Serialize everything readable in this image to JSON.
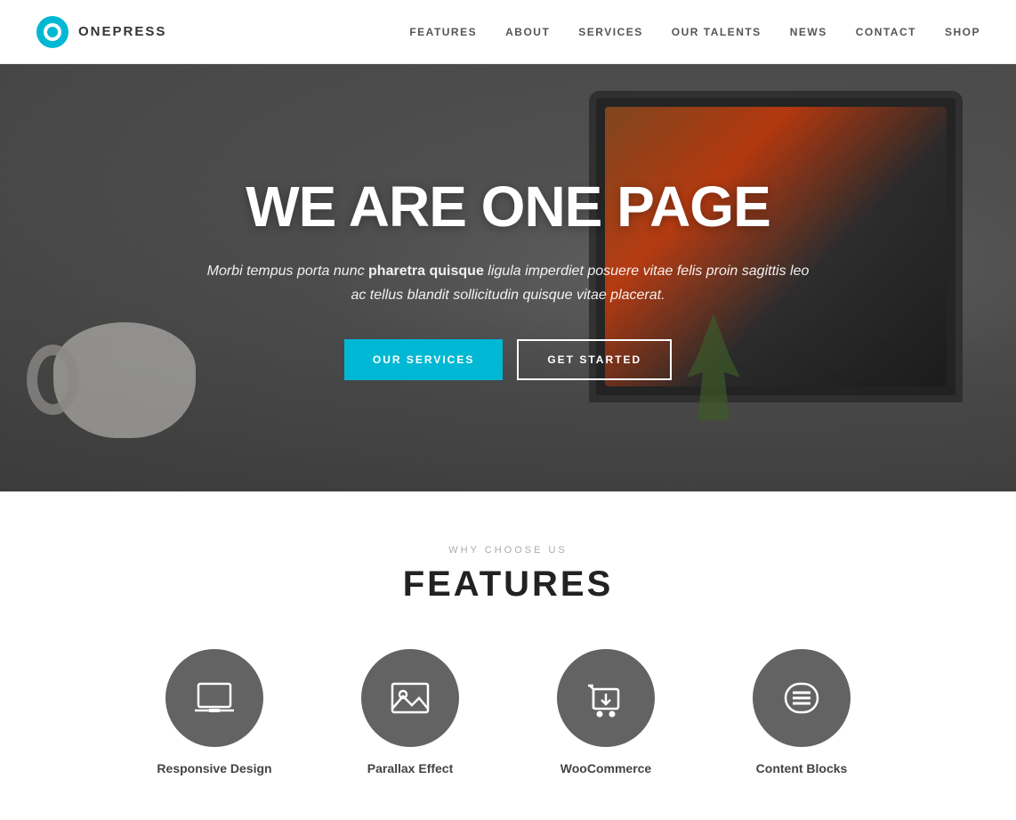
{
  "header": {
    "logo_text": "ONEPRESS",
    "nav": [
      {
        "label": "FEATURES",
        "href": "#features"
      },
      {
        "label": "ABOUT",
        "href": "#about"
      },
      {
        "label": "SERVICES",
        "href": "#services"
      },
      {
        "label": "OUR TALENTS",
        "href": "#talents"
      },
      {
        "label": "NEWS",
        "href": "#news"
      },
      {
        "label": "CONTACT",
        "href": "#contact"
      },
      {
        "label": "SHOP",
        "href": "#shop"
      }
    ]
  },
  "hero": {
    "title": "WE ARE ONE PAGE",
    "subtitle_plain": "Morbi tempus porta nunc ",
    "subtitle_bold": "pharetra quisque",
    "subtitle_end": " ligula imperdiet posuere vitae felis proin sagittis leo ac tellus blandit sollicitudin quisque vitae placerat.",
    "btn_primary": "OUR SERVICES",
    "btn_secondary": "GET STARTED"
  },
  "features": {
    "label": "WHY CHOOSE US",
    "title": "FEATURES",
    "items": [
      {
        "label": "Responsive Design",
        "icon": "laptop"
      },
      {
        "label": "Parallax Effect",
        "icon": "image"
      },
      {
        "label": "WooCommerce",
        "icon": "cart"
      },
      {
        "label": "Content Blocks",
        "icon": "menu"
      }
    ]
  }
}
